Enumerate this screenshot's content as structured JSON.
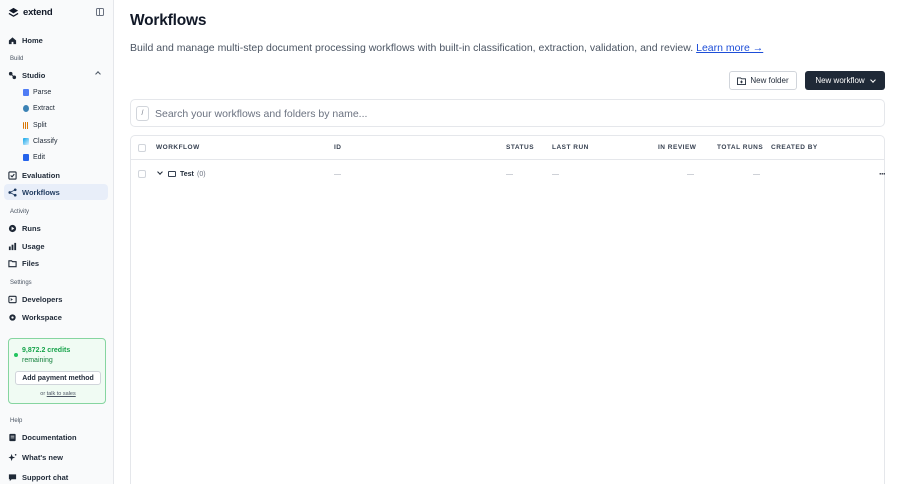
{
  "brand": {
    "name": "extend"
  },
  "sidebar": {
    "home": "Home",
    "build_label": "Build",
    "studio": "Studio",
    "studio_items": [
      {
        "label": "Parse",
        "color": "#4f7cf5"
      },
      {
        "label": "Extract",
        "color": "#3b82b5"
      },
      {
        "label": "Split",
        "color": "#d97706"
      },
      {
        "label": "Classify",
        "color": "#0ea5e9"
      },
      {
        "label": "Edit",
        "color": "#2563eb"
      }
    ],
    "evaluation": "Evaluation",
    "workflows": "Workflows",
    "activity_label": "Activity",
    "runs": "Runs",
    "usage": "Usage",
    "files": "Files",
    "settings_label": "Settings",
    "developers": "Developers",
    "workspace": "Workspace",
    "credits": {
      "amount": "9,872.2 credits",
      "remaining": "remaining",
      "pay_button": "Add payment method",
      "or_text": "or",
      "sales_link": "talk to sales"
    },
    "help_label": "Help",
    "documentation": "Documentation",
    "whats_new": "What's new",
    "support_chat": "Support chat"
  },
  "header": {
    "title": "Workflows",
    "description": "Build and manage multi-step document processing workflows with built-in classification, extraction, validation, and review.",
    "learn_more": "Learn more →",
    "new_folder": "New folder",
    "new_workflow": "New workflow"
  },
  "search": {
    "shortcut": "/",
    "placeholder": "Search your workflows and folders by name..."
  },
  "table": {
    "columns": [
      "Workflow",
      "ID",
      "Status",
      "Last run",
      "In review",
      "Total runs",
      "Created by"
    ],
    "rows": [
      {
        "name": "Test",
        "count": "(0)",
        "id": "—",
        "status": "—",
        "last_run": "—",
        "in_review": "—",
        "total_runs": "—",
        "created_by": "—",
        "more": "···"
      }
    ]
  },
  "colors": {
    "accent": "#1f2937",
    "active_nav": "#e8eef9",
    "credits_green": "#22c55e",
    "link": "#1d4ed8"
  }
}
